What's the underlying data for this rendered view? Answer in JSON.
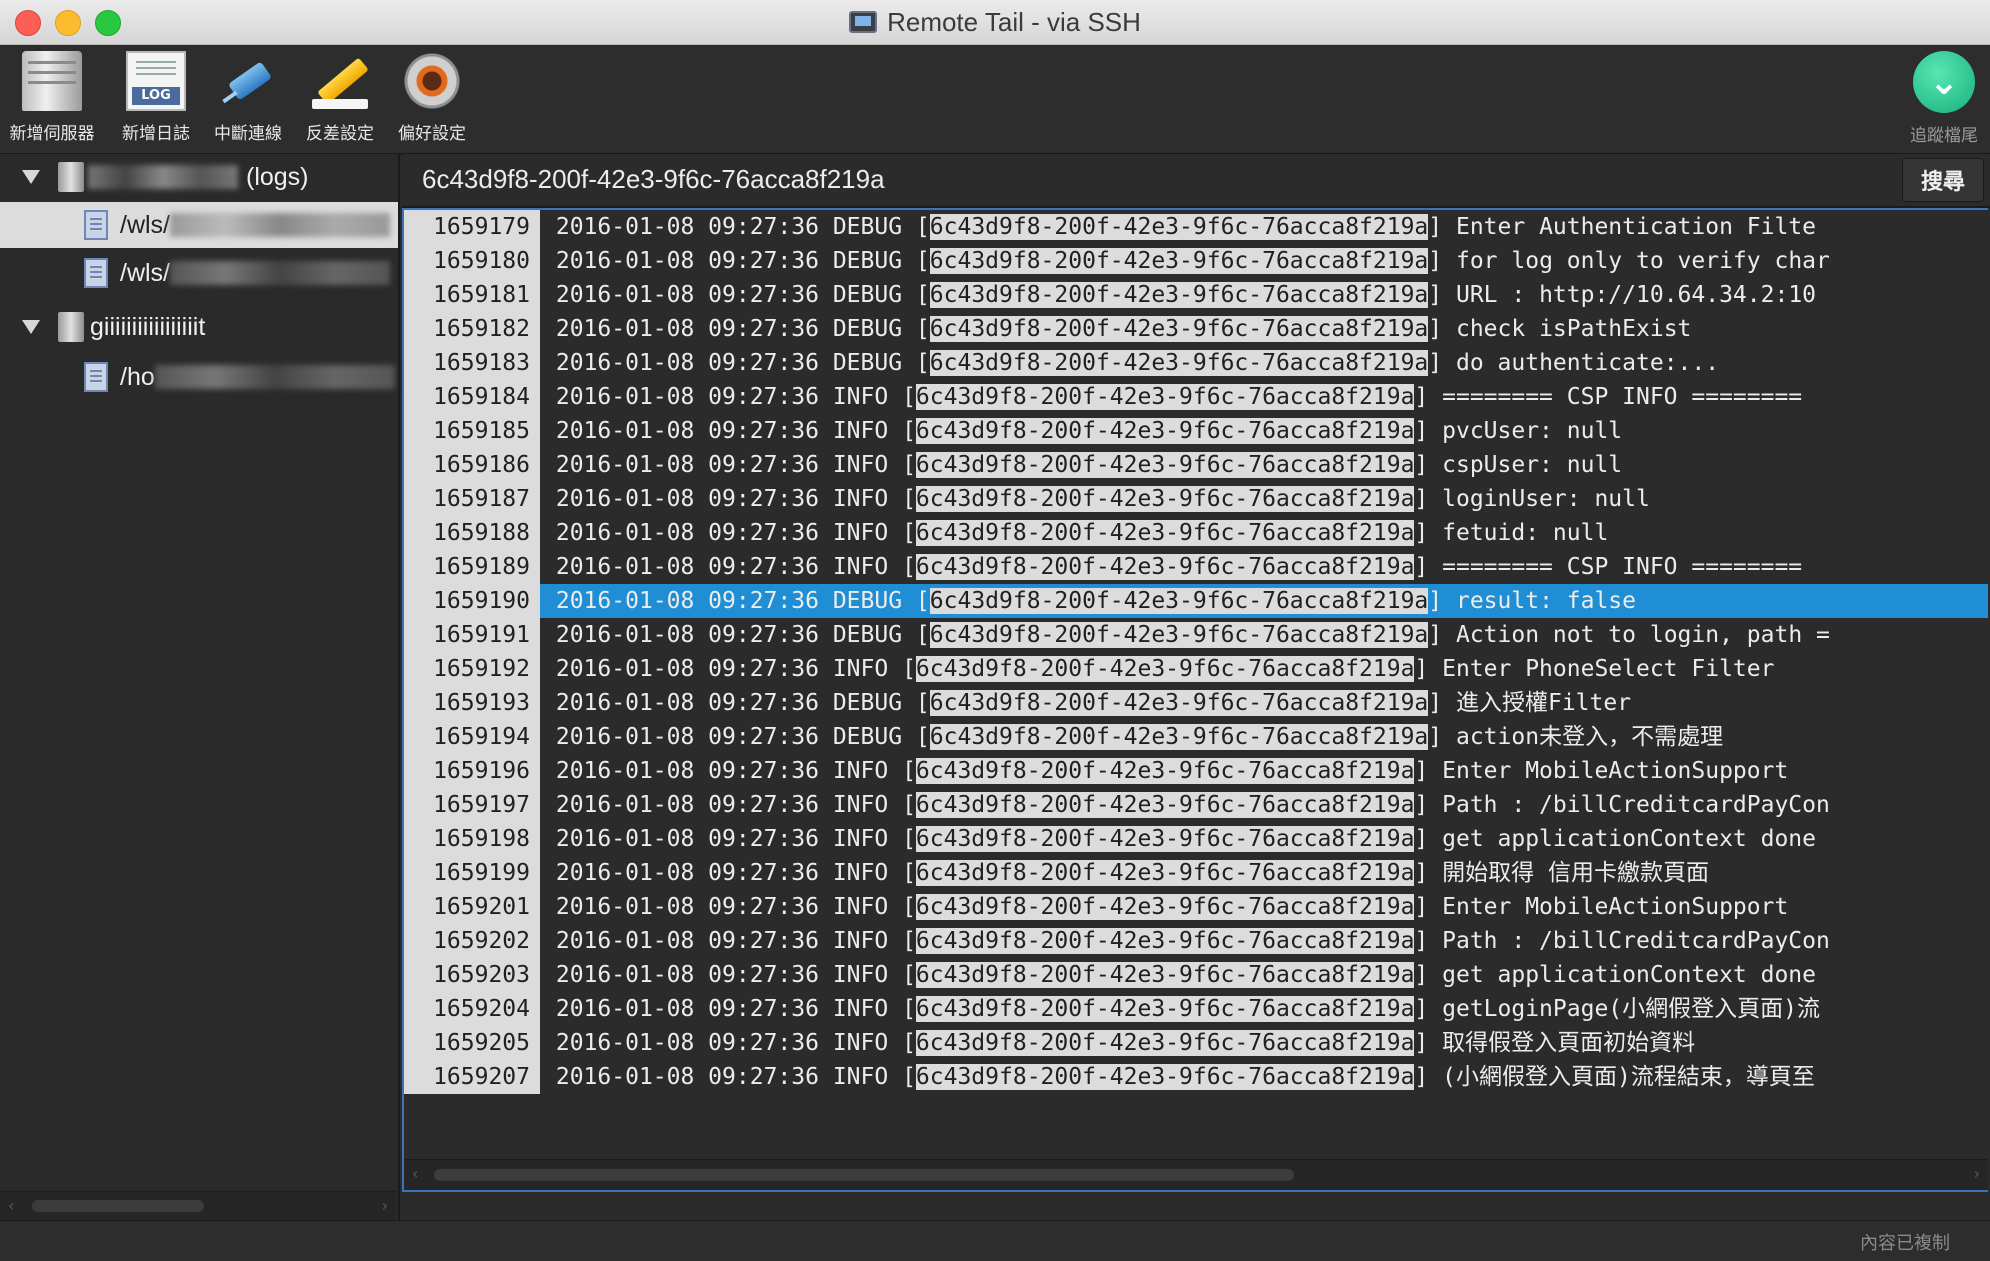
{
  "window": {
    "title": "Remote Tail - via SSH"
  },
  "toolbar": {
    "items": [
      {
        "label": "新增伺服器",
        "icon": "server-icon"
      },
      {
        "label": "新增日誌",
        "icon": "log-icon"
      },
      {
        "label": "中斷連線",
        "icon": "disconnect-icon"
      },
      {
        "label": "反差設定",
        "icon": "highlight-icon"
      },
      {
        "label": "偏好設定",
        "icon": "gear-icon"
      }
    ],
    "track": {
      "label": "追蹤檔尾",
      "icon": "chevron-down-icon"
    }
  },
  "sidebar": {
    "server1_suffix": "(logs)",
    "file1": "/wls/",
    "file2": "/wls/",
    "server2": "giiiiiiiiiiiiiiiiit",
    "file3": "/ho"
  },
  "search": {
    "value": "6c43d9f8-200f-42e3-9f6c-76acca8f219a",
    "button": "搜尋"
  },
  "log": {
    "rows": [
      {
        "n": "1659179",
        "ts": "2016-01-08 09:27:36",
        "lvl": "DEBUG",
        "id": "6c43d9f8-200f-42e3-9f6c-76acca8f219a",
        "msg": "Enter Authentication Filte"
      },
      {
        "n": "1659180",
        "ts": "2016-01-08 09:27:36",
        "lvl": "DEBUG",
        "id": "6c43d9f8-200f-42e3-9f6c-76acca8f219a",
        "msg": "for log only to verify char"
      },
      {
        "n": "1659181",
        "ts": "2016-01-08 09:27:36",
        "lvl": "DEBUG",
        "id": "6c43d9f8-200f-42e3-9f6c-76acca8f219a",
        "msg": "URL : http://10.64.34.2:10"
      },
      {
        "n": "1659182",
        "ts": "2016-01-08 09:27:36",
        "lvl": "DEBUG",
        "id": "6c43d9f8-200f-42e3-9f6c-76acca8f219a",
        "msg": "check isPathExist"
      },
      {
        "n": "1659183",
        "ts": "2016-01-08 09:27:36",
        "lvl": "DEBUG",
        "id": "6c43d9f8-200f-42e3-9f6c-76acca8f219a",
        "msg": "do authenticate:..."
      },
      {
        "n": "1659184",
        "ts": "2016-01-08 09:27:36",
        "lvl": "INFO",
        "id": "6c43d9f8-200f-42e3-9f6c-76acca8f219a",
        "msg": "======== CSP INFO ========"
      },
      {
        "n": "1659185",
        "ts": "2016-01-08 09:27:36",
        "lvl": "INFO",
        "id": "6c43d9f8-200f-42e3-9f6c-76acca8f219a",
        "msg": "pvcUser: null"
      },
      {
        "n": "1659186",
        "ts": "2016-01-08 09:27:36",
        "lvl": "INFO",
        "id": "6c43d9f8-200f-42e3-9f6c-76acca8f219a",
        "msg": "cspUser: null"
      },
      {
        "n": "1659187",
        "ts": "2016-01-08 09:27:36",
        "lvl": "INFO",
        "id": "6c43d9f8-200f-42e3-9f6c-76acca8f219a",
        "msg": "loginUser: null"
      },
      {
        "n": "1659188",
        "ts": "2016-01-08 09:27:36",
        "lvl": "INFO",
        "id": "6c43d9f8-200f-42e3-9f6c-76acca8f219a",
        "msg": "fetuid: null"
      },
      {
        "n": "1659189",
        "ts": "2016-01-08 09:27:36",
        "lvl": "INFO",
        "id": "6c43d9f8-200f-42e3-9f6c-76acca8f219a",
        "msg": "======== CSP INFO ========"
      },
      {
        "n": "1659190",
        "ts": "2016-01-08 09:27:36",
        "lvl": "DEBUG",
        "id": "6c43d9f8-200f-42e3-9f6c-76acca8f219a",
        "msg": "result: false"
      },
      {
        "n": "1659191",
        "ts": "2016-01-08 09:27:36",
        "lvl": "DEBUG",
        "id": "6c43d9f8-200f-42e3-9f6c-76acca8f219a",
        "msg": "Action not to login, path ="
      },
      {
        "n": "1659192",
        "ts": "2016-01-08 09:27:36",
        "lvl": "INFO",
        "id": "6c43d9f8-200f-42e3-9f6c-76acca8f219a",
        "msg": "Enter PhoneSelect Filter"
      },
      {
        "n": "1659193",
        "ts": "2016-01-08 09:27:36",
        "lvl": "DEBUG",
        "id": "6c43d9f8-200f-42e3-9f6c-76acca8f219a",
        "msg": "進入授權Filter"
      },
      {
        "n": "1659194",
        "ts": "2016-01-08 09:27:36",
        "lvl": "DEBUG",
        "id": "6c43d9f8-200f-42e3-9f6c-76acca8f219a",
        "msg": "action未登入，不需處理"
      },
      {
        "n": "1659196",
        "ts": "2016-01-08 09:27:36",
        "lvl": "INFO",
        "id": "6c43d9f8-200f-42e3-9f6c-76acca8f219a",
        "msg": "Enter MobileActionSupport"
      },
      {
        "n": "1659197",
        "ts": "2016-01-08 09:27:36",
        "lvl": "INFO",
        "id": "6c43d9f8-200f-42e3-9f6c-76acca8f219a",
        "msg": "Path : /billCreditcardPayCon"
      },
      {
        "n": "1659198",
        "ts": "2016-01-08 09:27:36",
        "lvl": "INFO",
        "id": "6c43d9f8-200f-42e3-9f6c-76acca8f219a",
        "msg": "get applicationContext done"
      },
      {
        "n": "1659199",
        "ts": "2016-01-08 09:27:36",
        "lvl": "INFO",
        "id": "6c43d9f8-200f-42e3-9f6c-76acca8f219a",
        "msg": "開始取得 信用卡繳款頁面"
      },
      {
        "n": "1659201",
        "ts": "2016-01-08 09:27:36",
        "lvl": "INFO",
        "id": "6c43d9f8-200f-42e3-9f6c-76acca8f219a",
        "msg": "Enter MobileActionSupport"
      },
      {
        "n": "1659202",
        "ts": "2016-01-08 09:27:36",
        "lvl": "INFO",
        "id": "6c43d9f8-200f-42e3-9f6c-76acca8f219a",
        "msg": "Path : /billCreditcardPayCon"
      },
      {
        "n": "1659203",
        "ts": "2016-01-08 09:27:36",
        "lvl": "INFO",
        "id": "6c43d9f8-200f-42e3-9f6c-76acca8f219a",
        "msg": "get applicationContext done"
      },
      {
        "n": "1659204",
        "ts": "2016-01-08 09:27:36",
        "lvl": "INFO",
        "id": "6c43d9f8-200f-42e3-9f6c-76acca8f219a",
        "msg": "getLoginPage(小網假登入頁面)流"
      },
      {
        "n": "1659205",
        "ts": "2016-01-08 09:27:36",
        "lvl": "INFO",
        "id": "6c43d9f8-200f-42e3-9f6c-76acca8f219a",
        "msg": "取得假登入頁面初始資料"
      },
      {
        "n": "1659207",
        "ts": "2016-01-08 09:27:36",
        "lvl": "INFO",
        "id": "6c43d9f8-200f-42e3-9f6c-76acca8f219a",
        "msg": "(小網假登入頁面)流程結束，導頁至"
      }
    ],
    "selected_line": "1659190"
  },
  "status": {
    "text": "內容已複制"
  },
  "colors": {
    "selection": "#1f8ed4",
    "highlight": "#dcdcdc",
    "focus_border": "#3d74b6"
  }
}
